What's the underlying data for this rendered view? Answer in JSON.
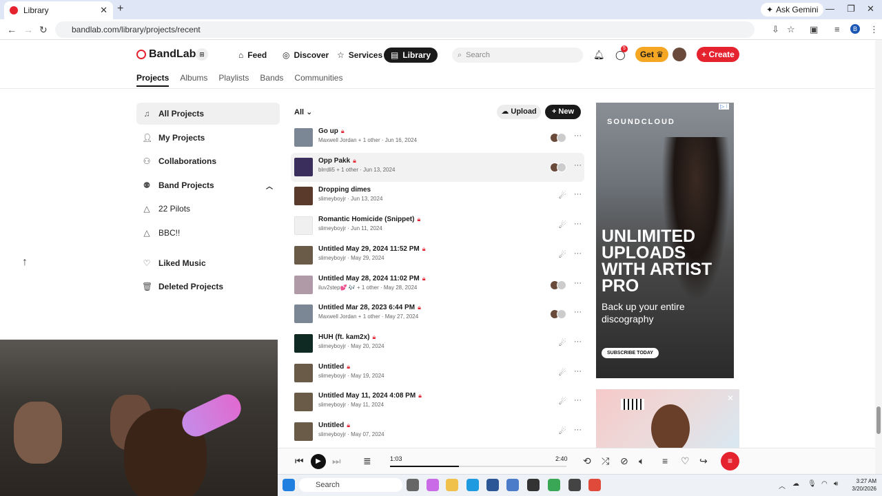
{
  "browser": {
    "tab_title": "Library",
    "url": "bandlab.com/library/projects/recent",
    "ask_gemini": "Ask Gemini",
    "profile_initial": "B"
  },
  "header": {
    "brand": "BandLab",
    "nav": [
      {
        "label": "Feed",
        "icon": "home-icon"
      },
      {
        "label": "Discover",
        "icon": "compass-icon"
      },
      {
        "label": "Services",
        "icon": "star-icon"
      },
      {
        "label": "Library",
        "icon": "library-icon",
        "active": true
      }
    ],
    "search_placeholder": "Search",
    "notif_count": "5",
    "get_label": "Get",
    "create_label": "Create"
  },
  "subnav": [
    "Projects",
    "Albums",
    "Playlists",
    "Bands",
    "Communities"
  ],
  "sidebar": {
    "items": [
      {
        "label": "All Projects",
        "icon": "music-note-icon"
      },
      {
        "label": "My Projects",
        "icon": "user-icon"
      },
      {
        "label": "Collaborations",
        "icon": "users-icon"
      },
      {
        "label": "Band Projects",
        "icon": "band-icon"
      },
      {
        "label": "22 Pilots",
        "icon": "band-small-icon"
      },
      {
        "label": "BBC!!",
        "icon": "band-small-icon"
      },
      {
        "label": "Liked Music",
        "icon": "heart-icon"
      },
      {
        "label": "Deleted Projects",
        "icon": "trash-icon"
      }
    ]
  },
  "list": {
    "filter": "All",
    "upload_label": "Upload",
    "new_label": "New",
    "projects": [
      {
        "title": "Go up",
        "locked": true,
        "meta": "Maxwell Jordan + 1 other",
        "date": "Jun 16, 2024",
        "thumb": "#7b8794",
        "collab": true
      },
      {
        "title": "Opp Pakk",
        "locked": true,
        "meta": "blrrdli5 + 1 other",
        "date": "Jun 13, 2024",
        "thumb": "#3a2f5c",
        "collab": true
      },
      {
        "title": "Dropping dimes",
        "locked": false,
        "meta": "slimeyboyjr",
        "date": "Jun 13, 2024",
        "thumb": "#5a3a2a",
        "collab": false
      },
      {
        "title": "Romantic Homicide (Snippet)",
        "locked": true,
        "meta": "slimeyboyjr",
        "date": "Jun 11, 2024",
        "thumb": "#f0f0f0",
        "collab": false
      },
      {
        "title": "Untitled May 29, 2024 11:52 PM",
        "locked": true,
        "meta": "slimeyboyjr",
        "date": "May 29, 2024",
        "thumb": "#6a5a48",
        "collab": false
      },
      {
        "title": "Untitled May 28, 2024 11:02 PM",
        "locked": true,
        "meta": "iluv2step💕 🎶 + 1 other",
        "date": "May 28, 2024",
        "thumb": "#b09aa8",
        "collab": true
      },
      {
        "title": "Untitled Mar 28, 2023 6:44 PM",
        "locked": true,
        "meta": "Maxwell Jordan + 1 other",
        "date": "May 27, 2024",
        "thumb": "#7b8794",
        "collab": true
      },
      {
        "title": "HUH (ft. kam2x)",
        "locked": true,
        "meta": "slimeyboyjr",
        "date": "May 20, 2024",
        "thumb": "#0f2a22",
        "collab": false
      },
      {
        "title": "Untitled",
        "locked": true,
        "meta": "slimeyboyjr",
        "date": "May 19, 2024",
        "thumb": "#6a5a48",
        "collab": false
      },
      {
        "title": "Untitled May 11, 2024 4:08 PM",
        "locked": true,
        "meta": "slimeyboyjr",
        "date": "May 11, 2024",
        "thumb": "#6a5a48",
        "collab": false
      },
      {
        "title": "Untitled",
        "locked": true,
        "meta": "slimeyboyjr",
        "date": "May 07, 2024",
        "thumb": "#6a5a48",
        "collab": false
      }
    ]
  },
  "ad": {
    "brand": "SOUNDCLOUD",
    "headline": "UNLIMITED UPLOADS WITH ARTIST PRO",
    "sub": "Back up your entire discography",
    "cta": "SUBSCRIBE TODAY"
  },
  "player": {
    "current": "1:03",
    "total": "2:40",
    "progress": 0.39
  },
  "taskbar": {
    "search": "Search",
    "time": "3:27 AM",
    "date": "3/20/2026"
  }
}
